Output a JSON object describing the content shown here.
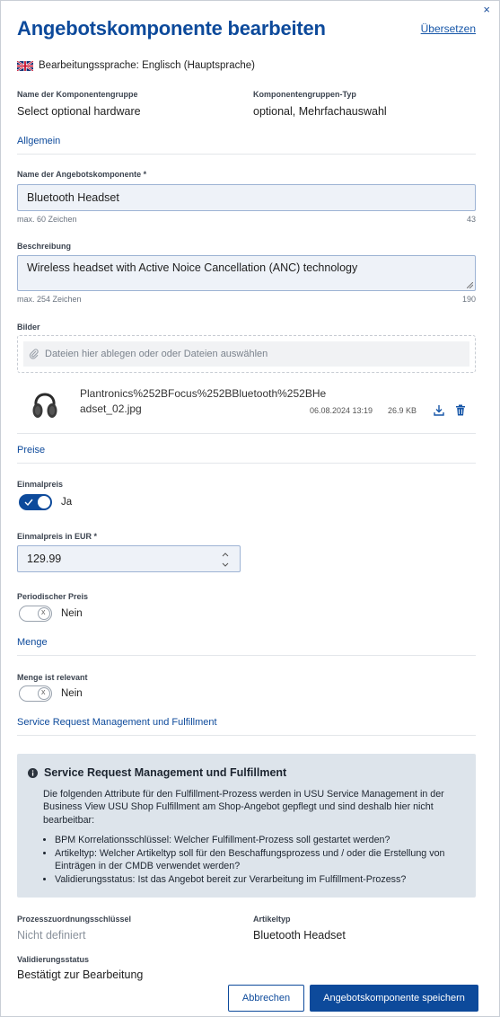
{
  "dialog": {
    "title": "Angebotskomponente bearbeiten",
    "close_glyph": "×",
    "translate_link": "Übersetzen"
  },
  "language": {
    "flag_icon": "uk-flag-icon",
    "text": "Bearbeitungssprache: Englisch (Hauptsprache)"
  },
  "group": {
    "name_label": "Name der Komponentengruppe",
    "name_value": "Select optional hardware",
    "type_label": "Komponentengruppen-Typ",
    "type_value": "optional, Mehrfachauswahl"
  },
  "sections": {
    "general": "Allgemein",
    "prices": "Preise",
    "quantity": "Menge",
    "srm": "Service Request Management und Fulfillment"
  },
  "component_name": {
    "label": "Name der Angebotskomponente *",
    "value": "Bluetooth Headset",
    "hint": "max. 60 Zeichen",
    "count": "43"
  },
  "description": {
    "label": "Beschreibung",
    "value": "Wireless headset with Active Noice Cancellation (ANC) technology",
    "hint": "max. 254 Zeichen",
    "count": "190"
  },
  "images": {
    "label": "Bilder",
    "drop_text": "Dateien hier ablegen oder oder Dateien auswählen",
    "file": {
      "name": "Plantronics%252BFocus%252BBluetooth%252BHeadset_02.jpg",
      "date": "06.08.2024 13:19",
      "size": "26.9 KB"
    }
  },
  "one_time_price": {
    "label": "Einmalpreis",
    "toggle_on": true,
    "toggle_text": "Ja",
    "amount_label": "Einmalpreis in EUR *",
    "amount_value": "129.99"
  },
  "periodic_price": {
    "label": "Periodischer Preis",
    "toggle_on": false,
    "toggle_text": "Nein"
  },
  "quantity": {
    "label": "Menge ist relevant",
    "toggle_on": false,
    "toggle_text": "Nein"
  },
  "info_box": {
    "title": "Service Request Management und Fulfillment",
    "intro": "Die folgenden Attribute für den Fulfillment-Prozess werden in USU Service Management in der Business View USU Shop Fulfillment am Shop-Angebot gepflegt und sind deshalb hier nicht bearbeitbar:",
    "bullets": [
      "BPM Korrelationsschlüssel: Welcher Fulfillment-Prozess soll gestartet werden?",
      "Artikeltyp: Welcher Artikeltyp soll für den Beschaffungsprozess und / oder die Erstellung von Einträgen in der CMDB verwendet werden?",
      "Validierungsstatus: Ist das Angebot bereit zur Verarbeitung im Fulfillment-Prozess?"
    ]
  },
  "fulfillment": {
    "process_key_label": "Prozesszuordnungsschlüssel",
    "process_key_value": "Nicht definiert",
    "article_type_label": "Artikeltyp",
    "article_type_value": "Bluetooth Headset",
    "validation_label": "Validierungsstatus",
    "validation_value": "Bestätigt zur Bearbeitung"
  },
  "buttons": {
    "cancel": "Abbrechen",
    "save": "Angebotskomponente speichern"
  },
  "colors": {
    "primary": "#0d4a9b",
    "info_bg": "#dde4eb",
    "input_bg": "#eef2f8"
  }
}
